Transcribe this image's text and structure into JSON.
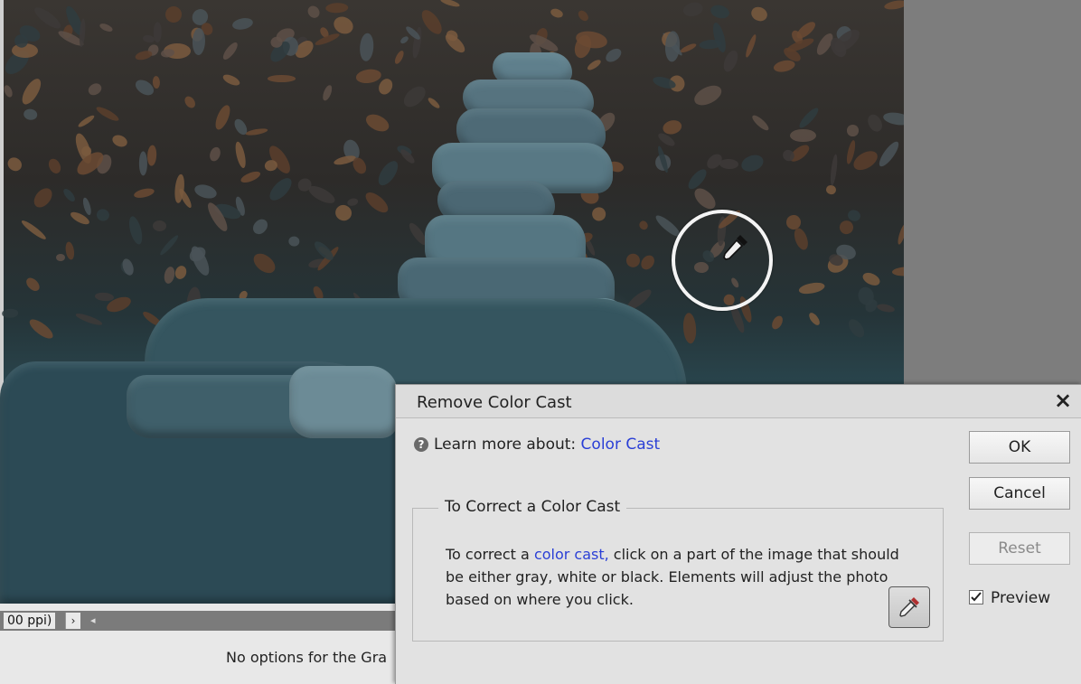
{
  "canvas": {
    "status_zoom_text": "00 ppi)",
    "status_arrow": "›",
    "scroll_left_glyph": "◂",
    "options_text": "No options for the Gra"
  },
  "dialog": {
    "title": "Remove Color Cast",
    "close_glyph": "×",
    "help_icon_glyph": "?",
    "help_prefix": "Learn more about: ",
    "help_link": "Color Cast",
    "group_title": "To Correct a Color Cast",
    "body_prefix": "To correct a ",
    "body_link": "color cast,",
    "body_rest": "  click on a part of the image that should be either gray, white or black. Elements will adjust the photo based on where you click.",
    "ok_label": "OK",
    "cancel_label": "Cancel",
    "reset_label": "Reset",
    "preview_label": "Preview",
    "preview_checked": true
  },
  "icons": {
    "help": "question-circle-icon",
    "close": "close-icon",
    "eyedropper": "eyedropper-icon",
    "cursor": "eyedropper-cursor-icon",
    "check": "checkmark-icon"
  },
  "colors": {
    "link": "#2a3fd6",
    "dialog_bg": "#e2e2e2",
    "side_panel": "#7d7d7d"
  }
}
